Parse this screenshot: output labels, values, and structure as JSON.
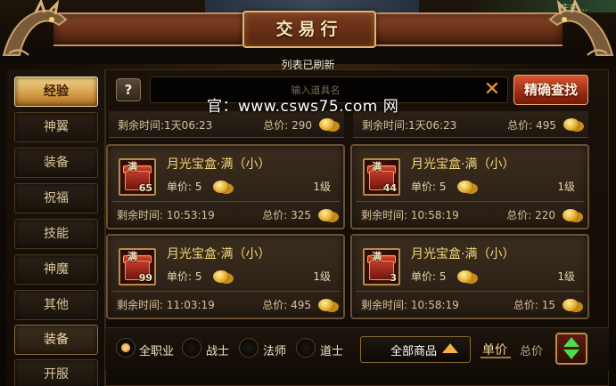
{
  "header": {
    "title": "交易行",
    "top_right_text": "主中…"
  },
  "refresh_notice": "列表已刷新",
  "watermark": "官：www.csws75.com 网",
  "sidebar": {
    "items": [
      {
        "label": "经验",
        "state": "active"
      },
      {
        "label": "神翼"
      },
      {
        "label": "装备"
      },
      {
        "label": "祝福"
      },
      {
        "label": "技能"
      },
      {
        "label": "神魔"
      },
      {
        "label": "其他"
      },
      {
        "label": "装备",
        "state": "section"
      },
      {
        "label": "开服"
      }
    ]
  },
  "search": {
    "help_label": "?",
    "placeholder": "输入道具名",
    "clear_label": "✕",
    "button_label": "精确查找"
  },
  "top_partial_row": [
    {
      "time_label": "剩余时间:",
      "time": "1天06:23",
      "total_label": "总价:",
      "total": "290"
    },
    {
      "time_label": "剩余时间:",
      "time": "1天06:23",
      "total_label": "总价:",
      "total": "495"
    }
  ],
  "listings": [
    {
      "name": "月光宝盒·满（小）",
      "badge": "满",
      "qty": "65",
      "unit_label": "单价:",
      "unit_price": "5",
      "level": "1级",
      "time_label": "剩余时间:",
      "time": "10:53:19",
      "total_label": "总价:",
      "total": "325"
    },
    {
      "name": "月光宝盒·满（小）",
      "badge": "满",
      "qty": "44",
      "unit_label": "单价:",
      "unit_price": "5",
      "level": "1级",
      "time_label": "剩余时间:",
      "time": "10:58:19",
      "total_label": "总价:",
      "total": "220"
    },
    {
      "name": "月光宝盒·满（小）",
      "badge": "满",
      "qty": "99",
      "unit_label": "单价:",
      "unit_price": "5",
      "level": "1级",
      "time_label": "剩余时间:",
      "time": "11:03:19",
      "total_label": "总价:",
      "total": "495"
    },
    {
      "name": "月光宝盒·满（小）",
      "badge": "满",
      "qty": "3",
      "unit_label": "单价:",
      "unit_price": "5",
      "level": "1级",
      "time_label": "剩余时间:",
      "time": "10:58:19",
      "total_label": "总价:",
      "total": "15"
    }
  ],
  "filters": {
    "classes": [
      {
        "label": "全职业",
        "checked": true
      },
      {
        "label": "战士",
        "checked": false
      },
      {
        "label": "法师",
        "checked": false
      },
      {
        "label": "道士",
        "checked": false
      }
    ],
    "category": "全部商品",
    "sort_unit_price": "单价",
    "sort_total_price": "总价"
  },
  "colors": {
    "accent_gold": "#f4d774",
    "search_button": "#b03a1a",
    "sort_arrows": "#4fdb4a"
  }
}
